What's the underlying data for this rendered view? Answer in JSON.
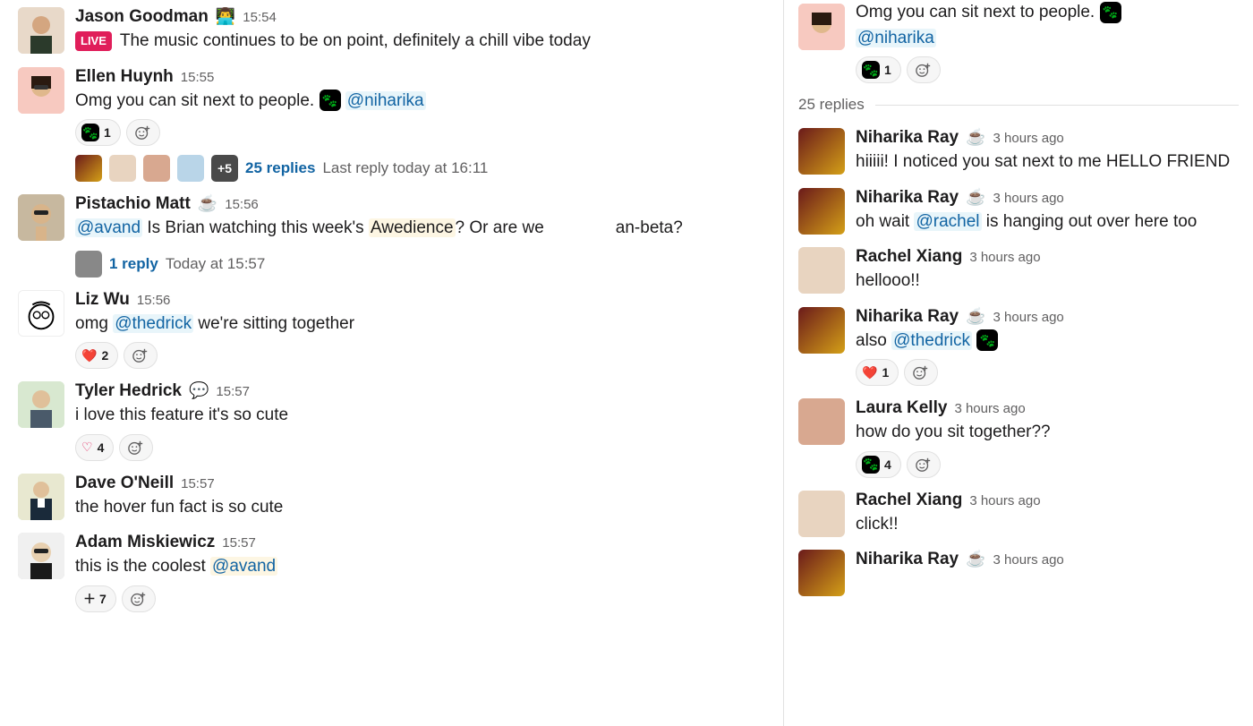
{
  "channel": {
    "messages": [
      {
        "sender": "Jason Goodman",
        "status_emoji": "👨‍💻",
        "time": "15:54",
        "live_badge": "LIVE",
        "body": "The music continues to be on point, definitely a chill vibe today"
      },
      {
        "sender": "Ellen Huynh",
        "time": "15:55",
        "pre_text": "Omg you can sit next to people. ",
        "mention": "@niharika",
        "reaction_emoji": "paw",
        "reaction_count": "1",
        "thread": {
          "more": "+5",
          "count": "25 replies",
          "meta": "Last reply today at 16:11"
        }
      },
      {
        "sender": "Pistachio Matt",
        "status_emoji": "☕",
        "time": "15:56",
        "mention_pre": "@avand",
        "body_mid1": " Is Brian watching this week's ",
        "highlight": "Awedience",
        "body_mid2": "? Or are we",
        "body_gap": " ",
        "body_tail": "an-beta?",
        "thread": {
          "count": "1 reply",
          "meta": "Today at 15:57"
        }
      },
      {
        "sender": "Liz Wu",
        "time": "15:56",
        "pre_text": "omg ",
        "mention": "@thedrick",
        "post_text": " we're sitting together",
        "reaction_emoji": "❤️",
        "reaction_count": "2"
      },
      {
        "sender": "Tyler Hedrick",
        "status_emoji": "💬",
        "time": "15:57",
        "body": "i love this feature it's so cute",
        "reaction_emoji": "❤️",
        "reaction_outline": true,
        "reaction_count": "4"
      },
      {
        "sender": "Dave O'Neill",
        "time": "15:57",
        "body": "the hover fun fact is so cute"
      },
      {
        "sender": "Adam Miskiewicz",
        "time": "15:57",
        "pre_text": "this is the coolest ",
        "mention": "@avand",
        "plus_count": "7"
      }
    ]
  },
  "thread": {
    "parent": {
      "pre_text": "Omg you can sit next to people. ",
      "mention": "@niharika",
      "reaction_count": "1"
    },
    "divider": "25 replies",
    "replies": [
      {
        "sender": "Niharika Ray",
        "status_emoji": "☕",
        "time": "3 hours ago",
        "body": "hiiiii! I noticed you sat next to me HELLO FRIEND"
      },
      {
        "sender": "Niharika Ray",
        "status_emoji": "☕",
        "time": "3 hours ago",
        "pre_text": "oh wait ",
        "mention": "@rachel",
        "post_text": " is hanging out over here too"
      },
      {
        "sender": "Rachel Xiang",
        "time": "3 hours ago",
        "body": "hellooo!!"
      },
      {
        "sender": "Niharika Ray",
        "status_emoji": "☕",
        "time": "3 hours ago",
        "pre_text": "also ",
        "mention": "@thedrick",
        "show_paw": true,
        "reaction_emoji": "❤️",
        "reaction_count": "1"
      },
      {
        "sender": "Laura Kelly",
        "time": "3 hours ago",
        "body": "how do you sit together??",
        "reaction_emoji": "paw",
        "reaction_count": "4"
      },
      {
        "sender": "Rachel Xiang",
        "time": "3 hours ago",
        "body": "click!!"
      },
      {
        "sender": "Niharika Ray",
        "status_emoji": "☕",
        "time": "3 hours ago"
      }
    ]
  }
}
